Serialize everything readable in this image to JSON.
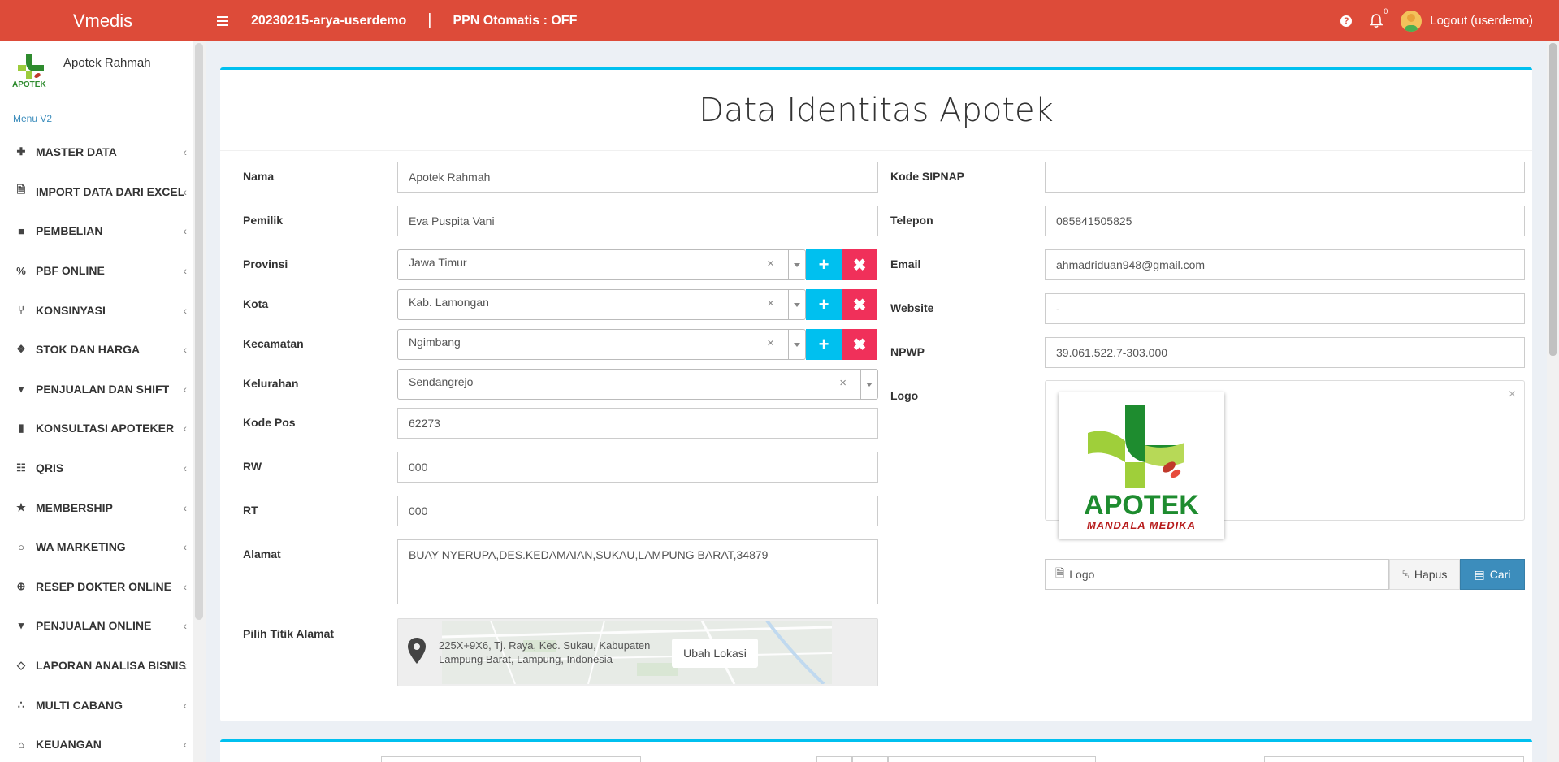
{
  "app": {
    "brand": "Vmedis",
    "user_label": "20230215-arya-userdemo",
    "ppn_label": "PPN Otomatis : OFF",
    "notif_count": "0",
    "logout_label": "Logout (userdemo)",
    "help_icon": "?"
  },
  "sidebar": {
    "store_name": "Apotek Rahmah",
    "menu_version": "Menu V2",
    "items": [
      {
        "label": "MASTER DATA",
        "icon": "plus-square-icon"
      },
      {
        "label": "IMPORT DATA DARI EXCEL",
        "icon": "excel-file-icon"
      },
      {
        "label": "PEMBELIAN",
        "icon": "truck-icon"
      },
      {
        "label": "PBF ONLINE",
        "icon": "percent-icon"
      },
      {
        "label": "KONSINYASI",
        "icon": "share-icon"
      },
      {
        "label": "STOK DAN HARGA",
        "icon": "cubes-icon"
      },
      {
        "label": "PENJUALAN DAN SHIFT",
        "icon": "cart-icon"
      },
      {
        "label": "KONSULTASI APOTEKER",
        "icon": "book-icon"
      },
      {
        "label": "QRIS",
        "icon": "qrcode-icon"
      },
      {
        "label": "MEMBERSHIP",
        "icon": "star-icon"
      },
      {
        "label": "WA MARKETING",
        "icon": "whatsapp-icon"
      },
      {
        "label": "RESEP DOKTER ONLINE",
        "icon": "medkit-icon"
      },
      {
        "label": "PENJUALAN ONLINE",
        "icon": "cart-icon"
      },
      {
        "label": "LAPORAN ANALISA BISNIS",
        "icon": "diamond-icon"
      },
      {
        "label": "MULTI CABANG",
        "icon": "sitemap-icon"
      },
      {
        "label": "KEUANGAN",
        "icon": "bank-icon"
      }
    ]
  },
  "page": {
    "title": "Data Identitas Apotek"
  },
  "form": {
    "nama": {
      "label": "Nama",
      "value": "Apotek Rahmah"
    },
    "pemilik": {
      "label": "Pemilik",
      "value": "Eva Puspita Vani"
    },
    "provinsi": {
      "label": "Provinsi",
      "value": "Jawa Timur"
    },
    "kota": {
      "label": "Kota",
      "value": "Kab. Lamongan"
    },
    "kecamatan": {
      "label": "Kecamatan",
      "value": "Ngimbang"
    },
    "kelurahan": {
      "label": "Kelurahan",
      "value": "Sendangrejo"
    },
    "kode_pos": {
      "label": "Kode Pos",
      "value": "62273"
    },
    "rw": {
      "label": "RW",
      "value": "000"
    },
    "rt": {
      "label": "RT",
      "value": "000"
    },
    "alamat": {
      "label": "Alamat",
      "value": "BUAY NYERUPA,DES.KEDAMAIAN,SUKAU,LAMPUNG BARAT,34879"
    },
    "titik": {
      "label": "Pilih Titik Alamat",
      "address": "225X+9X6, Tj. Raya, Kec. Sukau, Kabupaten Lampung Barat, Lampung, Indonesia",
      "button": "Ubah Lokasi"
    },
    "kode_sipnap": {
      "label": "Kode SIPNAP",
      "value": ""
    },
    "telepon": {
      "label": "Telepon",
      "value": "085841505825"
    },
    "email": {
      "label": "Email",
      "value": "ahmadriduan948@gmail.com"
    },
    "website": {
      "label": "Website",
      "value": "-"
    },
    "npwp": {
      "label": "NPWP",
      "value": "39.061.522.7-303.000"
    },
    "logo": {
      "label": "Logo",
      "file_label": "Logo",
      "hapus": "Hapus",
      "cari": "Cari",
      "logo_text_main": "APOTEK",
      "logo_text_sub": "MANDALA MEDIKA"
    }
  },
  "colors": {
    "topbar": "#dd4b39",
    "accent": "#00c0ef",
    "danger": "#f0305a",
    "primary": "#3c8dbc"
  }
}
